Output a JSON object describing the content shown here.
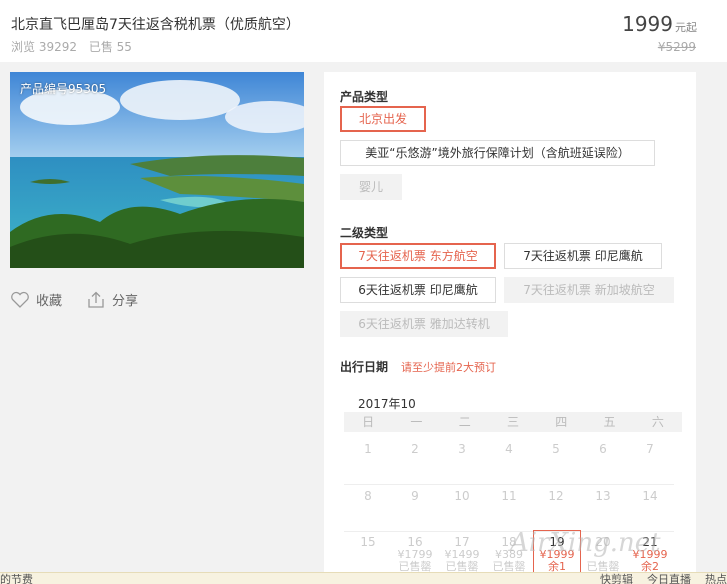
{
  "header": {
    "title": "北京直飞巴厘岛7天往返含税机票（优质航空）",
    "views": "浏览 39292",
    "sold": "已售 55",
    "price": "1999",
    "price_unit": "元起",
    "original_price": "¥5299"
  },
  "photo": {
    "product_no": "产品编号95305"
  },
  "actions": {
    "favorite": "收藏",
    "share": "分享"
  },
  "product_type": {
    "label": "产品类型",
    "options": [
      "北京出发",
      "美亚“乐悠游”境外旅行保障计划（含航班延误险）",
      "婴儿"
    ]
  },
  "secondary_type": {
    "label": "二级类型",
    "options": [
      "7天往返机票 东方航空",
      "7天往返机票 印尼鹰航",
      "6天往返机票 印尼鹰航",
      "7天往返机票 新加坡航空",
      "6天往返机票 雅加达转机"
    ]
  },
  "date": {
    "label": "出行日期",
    "hint": "请至少提前2大预订",
    "month": "2017年10",
    "weekdays": [
      "日",
      "一",
      "二",
      "三",
      "四",
      "五",
      "六"
    ],
    "row1": [
      "1",
      "2",
      "3",
      "4",
      "5",
      "6",
      "7"
    ],
    "row2": [
      "8",
      "9",
      "10",
      "11",
      "12",
      "13",
      "14"
    ],
    "row3": [
      "15",
      "16",
      "17",
      "18",
      "19",
      "20",
      "21"
    ],
    "row3_prices": [
      "",
      "¥1799",
      "¥1499",
      "¥389",
      "¥1999",
      "",
      "¥1999"
    ],
    "row3_sub": [
      "",
      "已售罄",
      "已售罄",
      "已售罄",
      "余1",
      "已售罄",
      "余2"
    ]
  },
  "watermark": "AirXing.net",
  "bottombar": {
    "left": "的节费",
    "r1": "快剪辑",
    "r2": "今日直播",
    "r3": "热点"
  }
}
